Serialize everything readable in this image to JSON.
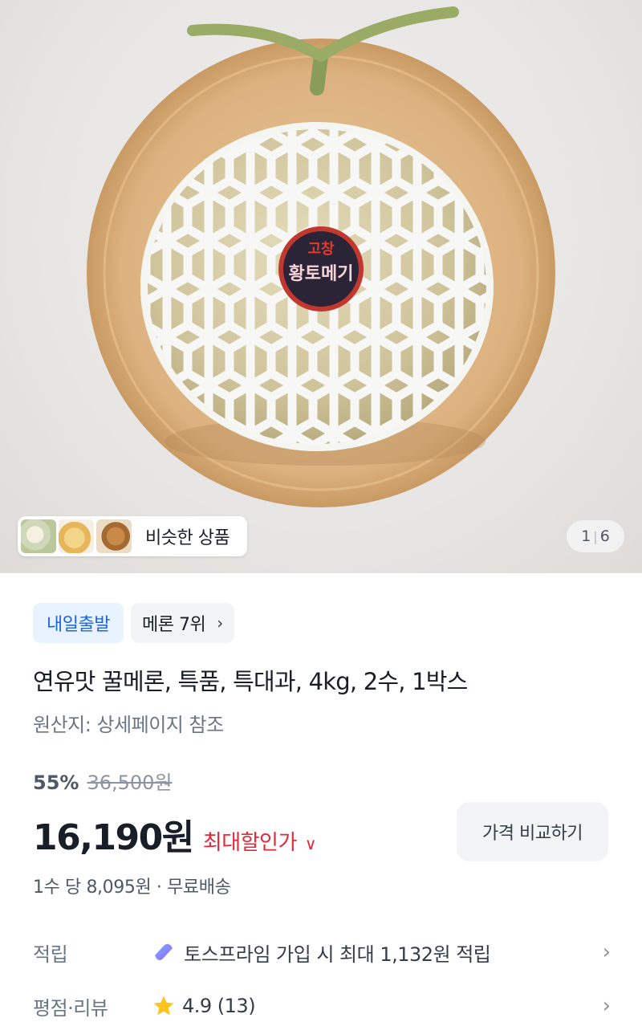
{
  "hero": {
    "label_top": "고창",
    "label_main": "황토메기",
    "similar_label": "비슷한 상품",
    "page_current": "1",
    "page_total": "6"
  },
  "badges": {
    "delivery": "내일출발",
    "rank": "메론 7위"
  },
  "product": {
    "title": "연유맛 꿀메론, 특품, 특대과, 4kg, 2수, 1박스",
    "origin": "원산지: 상세페이지 참조"
  },
  "price": {
    "discount": "55%",
    "original": "36,500원",
    "final": "16,190원",
    "max_discount_label": "최대할인가",
    "compare_button": "가격 비교하기",
    "unit_info": "1수 당 8,095원 · 무료배송"
  },
  "points": {
    "label": "적립",
    "value": "토스프라임 가입 시 최대 1,132원 적립"
  },
  "rating": {
    "label": "평점·리뷰",
    "value": "4.9 (13)"
  },
  "colors": {
    "accent_blue": "#1b64da",
    "sale_red": "#e42939",
    "star": "#ffc31e"
  }
}
